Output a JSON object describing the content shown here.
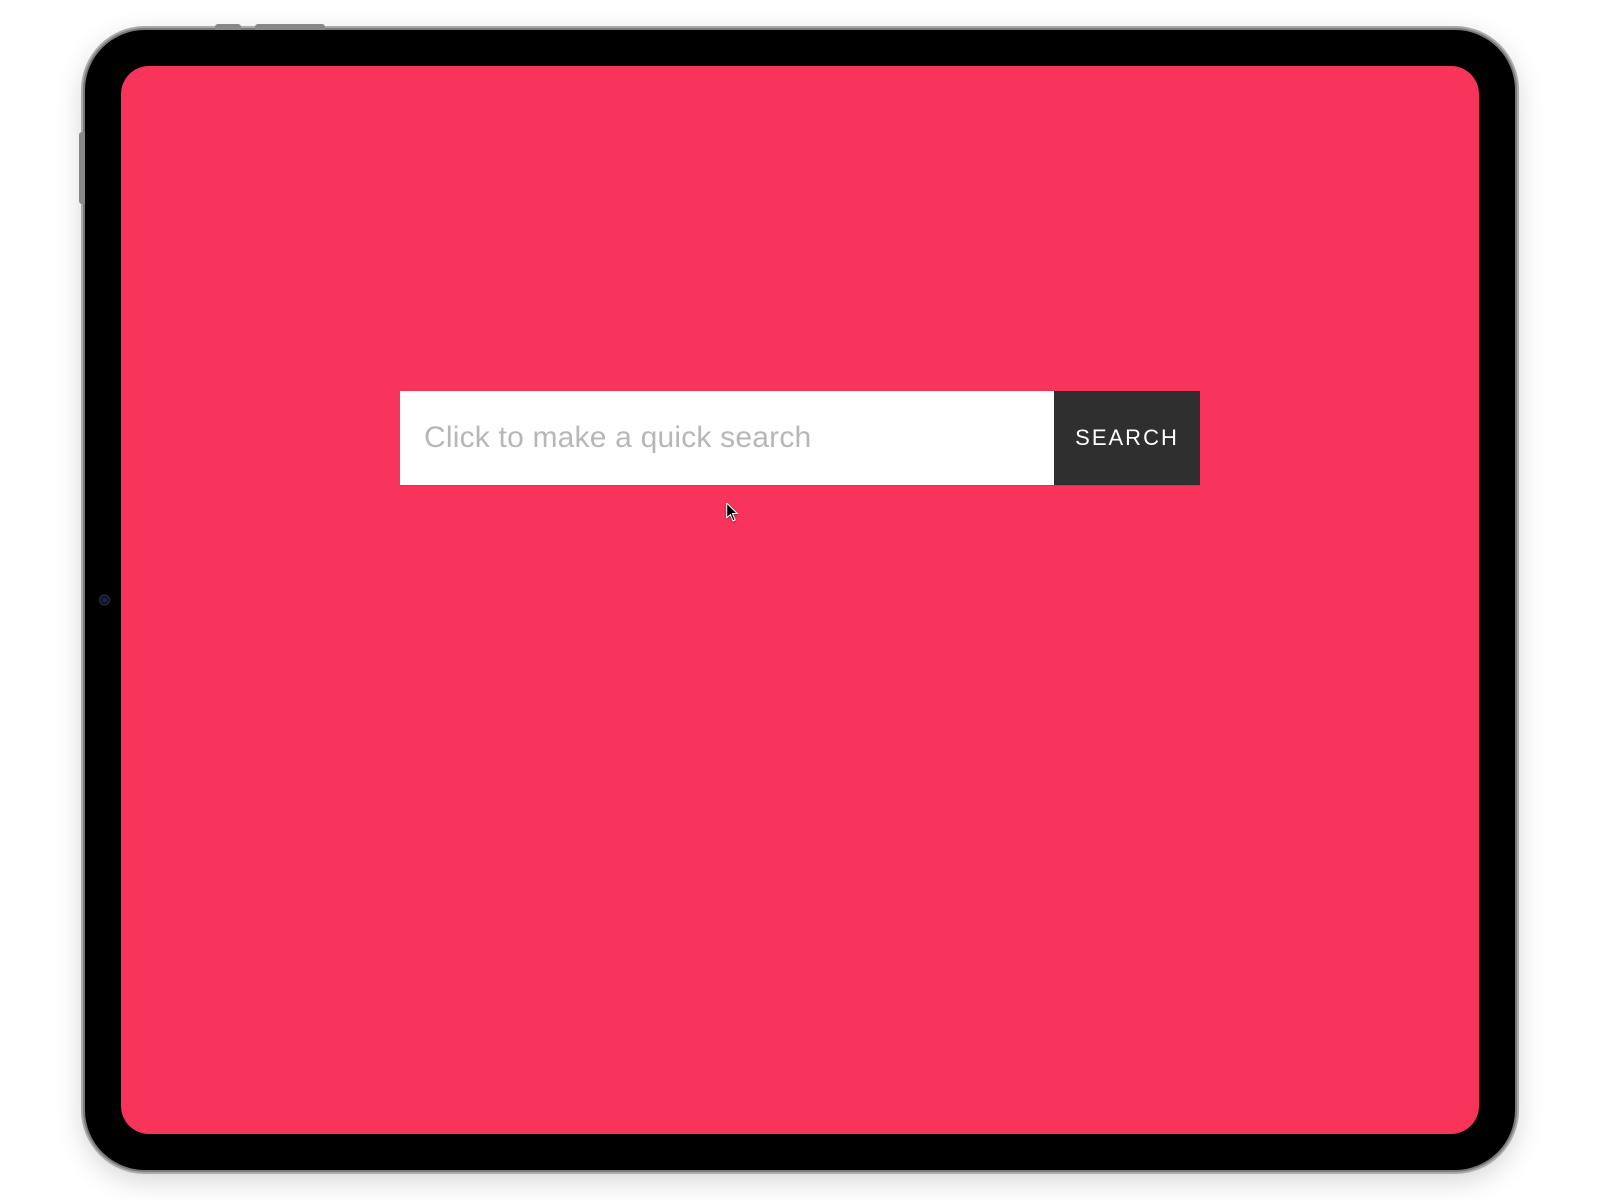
{
  "search": {
    "placeholder": "Click to make a quick search",
    "value": "",
    "button_label": "SEARCH"
  },
  "colors": {
    "background": "#f9345a",
    "button_bg": "#2f2f2f",
    "button_text": "#ffffff",
    "input_bg": "#ffffff",
    "placeholder": "#b7b7b7"
  }
}
